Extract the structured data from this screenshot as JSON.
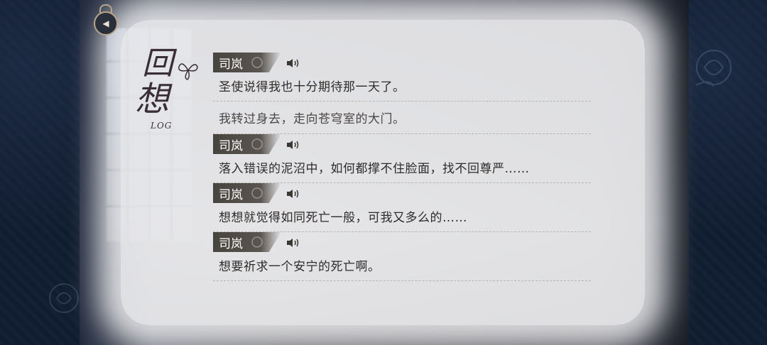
{
  "title": {
    "char1": "回",
    "char2": "想",
    "sub": "LOG"
  },
  "back_button": {
    "icon": "back-arrow-icon"
  },
  "entries": [
    {
      "speaker": "司岚",
      "text": "圣使说得我也十分期待那一天了。"
    },
    {
      "speaker": "",
      "text": "我转过身去，走向苍穹室的大门。"
    },
    {
      "speaker": "司岚",
      "text": "落入错误的泥沼中，如何都撑不住脸面，找不回尊严……"
    },
    {
      "speaker": "司岚",
      "text": "想想就觉得如同死亡一般，可我又多么的……"
    },
    {
      "speaker": "司岚",
      "text": "想要祈求一个安宁的死亡啊。"
    }
  ],
  "colors": {
    "nameplate": "#47433f",
    "panel": "#ececee",
    "side": "#101c30"
  }
}
